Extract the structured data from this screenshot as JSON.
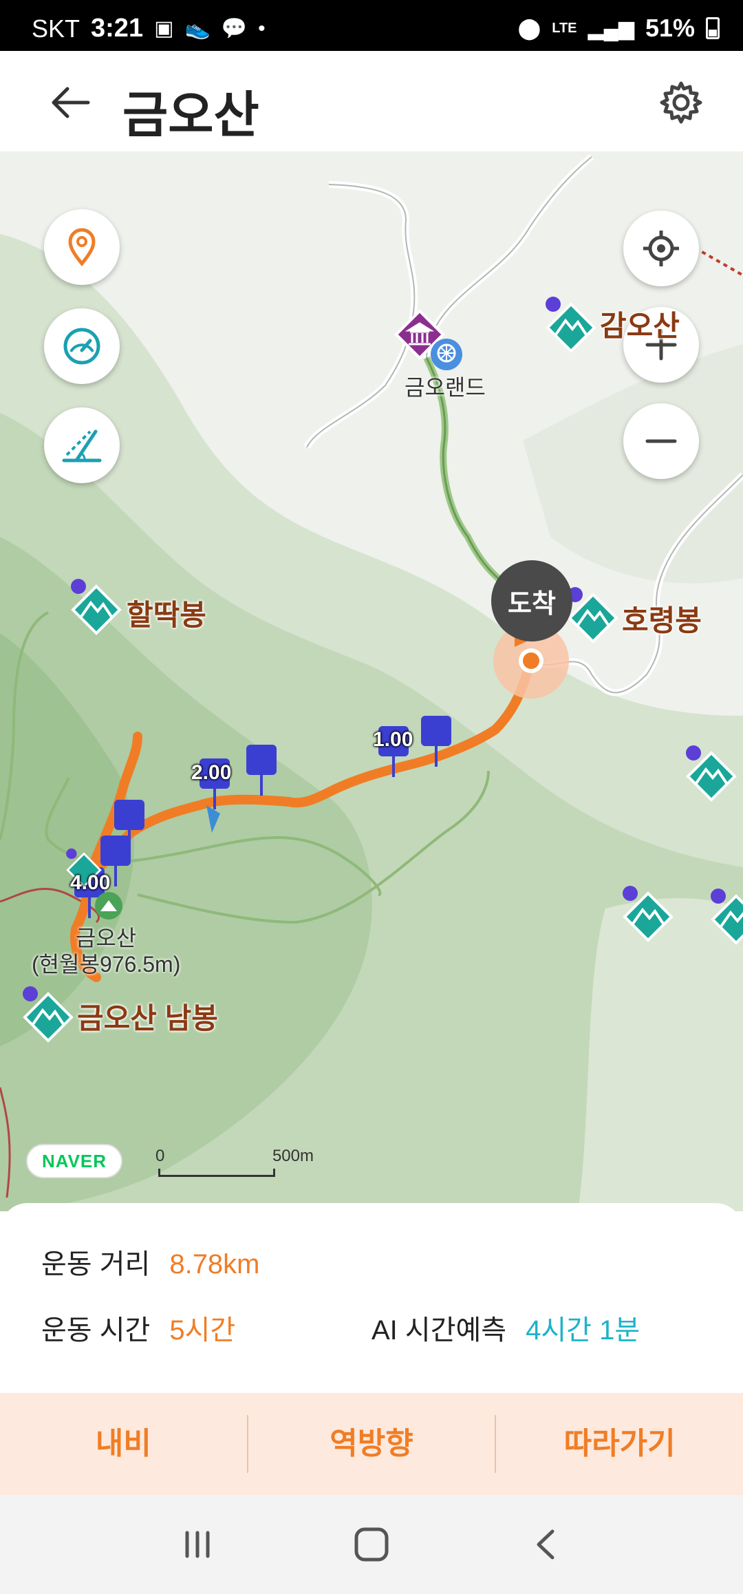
{
  "status_bar": {
    "carrier": "SKT",
    "time": "3:21",
    "network": "LTE",
    "battery": "51%",
    "icons": [
      "gallery-icon",
      "pedometer-icon",
      "chat-icon",
      "dot-icon",
      "location-icon",
      "lte-icon",
      "signal-icon",
      "battery-icon"
    ]
  },
  "header": {
    "title": "금오산",
    "back_icon": "arrow-left-icon",
    "settings_icon": "gear-icon"
  },
  "map": {
    "left_controls": [
      "location-pin-icon",
      "speedometer-icon",
      "slope-icon"
    ],
    "right_controls": [
      "my-location-icon",
      "zoom-in-icon",
      "zoom-out-icon"
    ],
    "peaks": {
      "p1": "감오산",
      "halttak": "할딱봉",
      "horyeong": "호령봉",
      "nambong": "금오산 남봉"
    },
    "places": {
      "land": "금오랜드",
      "summit_name": "금오산",
      "summit_detail": "(현월봉976.5m)"
    },
    "km_markers": [
      "1.00",
      "2.00",
      "4.00"
    ],
    "arrive_label": "도착",
    "logo": "NAVER",
    "scale": {
      "zero": "0",
      "distance": "500m"
    },
    "route_color": "#f07d25"
  },
  "info": {
    "distance_label": "운동 거리",
    "distance_value": "8.78km",
    "time_label": "운동 시간",
    "time_value": "5시간",
    "ai_label": "AI 시간예측",
    "ai_value": "4시간 1분"
  },
  "actions": {
    "navi": "내비",
    "reverse": "역방향",
    "follow": "따라가기"
  },
  "nav_bar": {
    "recents_icon": "recents-icon",
    "home_icon": "home-icon",
    "back_icon": "back-chevron-icon"
  }
}
